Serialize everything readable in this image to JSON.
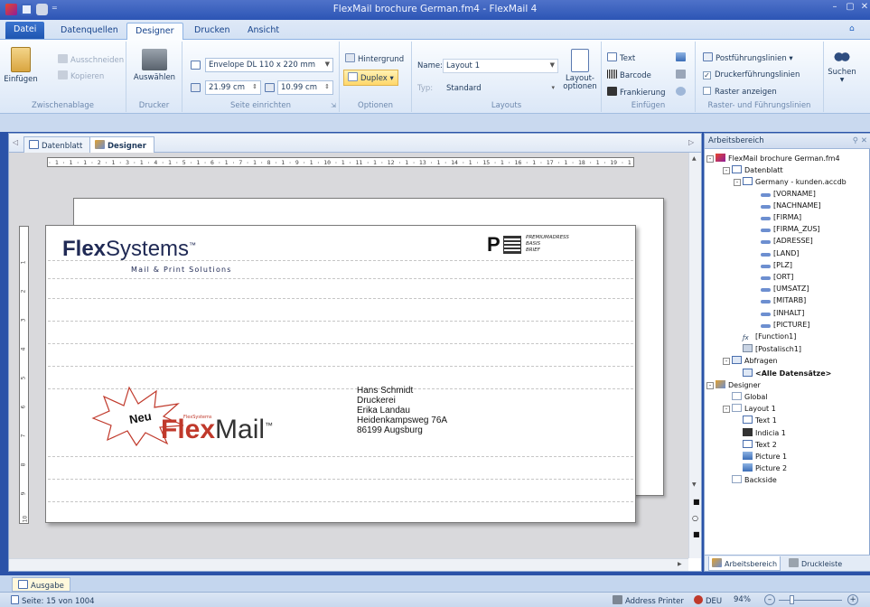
{
  "window": {
    "title": "FlexMail brochure German.fm4 - FlexMail 4",
    "qat": [
      "app-icon",
      "save-icon",
      "print-icon",
      "customize-arrow"
    ],
    "controls": [
      "minimize",
      "restore",
      "close"
    ]
  },
  "tabs": [
    {
      "label": "Datei",
      "active": false
    },
    {
      "label": "Datenquellen",
      "active": false
    },
    {
      "label": "Designer",
      "active": true
    },
    {
      "label": "Drucken",
      "active": false
    },
    {
      "label": "Ansicht",
      "active": false
    }
  ],
  "ribbon": {
    "clipboard": {
      "paste": "Einfügen",
      "cut": "Ausschneiden",
      "copy": "Kopieren",
      "label": "Zwischenablage"
    },
    "printer": {
      "select": "Auswählen",
      "label": "Drucker"
    },
    "page_setup": {
      "envelope": "Envelope DL 110 x 220 mm",
      "width": "21.99 cm",
      "height": "10.99 cm",
      "label": "Seite einrichten"
    },
    "options": {
      "background": "Hintergrund",
      "duplex": "Duplex",
      "label": "Optionen"
    },
    "layouts": {
      "name_label": "Name:",
      "name_value": "Layout 1",
      "type_label": "Typ:",
      "type_value": "Standard",
      "layout_options": "Layout-\noptionen",
      "label": "Layouts"
    },
    "insert": {
      "text": "Text",
      "barcode": "Barcode",
      "postage": "Frankierung",
      "label": "Einfügen"
    },
    "grid": {
      "postal_guides": "Postführungslinien",
      "printer_guides": "Druckerführungslinien",
      "show_grid": "Raster anzeigen",
      "printer_guides_checked": true,
      "show_grid_checked": false,
      "label": "Raster- und Führungslinien"
    },
    "search": {
      "label": "Suchen"
    }
  },
  "doc_tabs": [
    "Datenblatt",
    "Designer"
  ],
  "ruler_h": "· 1 · 1 · 1 · 2 · 1 · 3 · 1 · 4 · 1 · 5 · 1 · 6 · 1 · 7 · 1 · 8 · 1 · 9 · 1 · 10 · 1 · 11 · 1 · 12 · 1 · 13 · 1 · 14 · 1 · 15 · 1 · 16 · 1 · 17 · 1 · 18 · 1 · 19 · 1 · 20 · 1 · 21 · 1 ·",
  "ruler_v": [
    "1",
    "2",
    "3",
    "4",
    "5",
    "6",
    "7",
    "8",
    "9",
    "10"
  ],
  "envelope": {
    "logo_bold": "Flex",
    "logo_rest": "Systems",
    "logo_tm": "™",
    "logo_sub": "Mail & Print Solutions",
    "postage_p": "P",
    "postage_lines": [
      "PREMIUMADRESS",
      "BASIS",
      "BRIEF"
    ],
    "burst_text": "Neu",
    "flexmail_small": "FlexSystems",
    "flexmail_bold": "Flex",
    "flexmail_rest": "Mail",
    "flexmail_tm": "™",
    "address": [
      "Hans Schmidt",
      "Druckerei",
      "Erika Landau",
      "Heidenkampsweg 76A",
      "86199 Augsburg"
    ]
  },
  "panel": {
    "title": "Arbeitsbereich",
    "tree": [
      {
        "label": "FlexMail brochure German.fm4",
        "level": 0,
        "exp": "-",
        "icon": "project"
      },
      {
        "label": "Datenblatt",
        "level": 1,
        "exp": "-",
        "icon": "sheet"
      },
      {
        "label": "Germany - kunden.accdb",
        "level": 2,
        "exp": "-",
        "icon": "db"
      },
      {
        "label": "[VORNAME]",
        "level": 3,
        "icon": "field"
      },
      {
        "label": "[NACHNAME]",
        "level": 3,
        "icon": "field"
      },
      {
        "label": "[FIRMA]",
        "level": 3,
        "icon": "field"
      },
      {
        "label": "[FIRMA_ZUS]",
        "level": 3,
        "icon": "field"
      },
      {
        "label": "[ADRESSE]",
        "level": 3,
        "icon": "field"
      },
      {
        "label": "[LAND]",
        "level": 3,
        "icon": "field"
      },
      {
        "label": "[PLZ]",
        "level": 3,
        "icon": "field"
      },
      {
        "label": "[ORT]",
        "level": 3,
        "icon": "field"
      },
      {
        "label": "[UMSATZ]",
        "level": 3,
        "icon": "field"
      },
      {
        "label": "[MITARB]",
        "level": 3,
        "icon": "field"
      },
      {
        "label": "[INHALT]",
        "level": 3,
        "icon": "field"
      },
      {
        "label": "[PICTURE]",
        "level": 3,
        "icon": "field"
      },
      {
        "label": "[Function1]",
        "level": 2,
        "icon": "function"
      },
      {
        "label": "[Postalisch1]",
        "level": 2,
        "icon": "postal"
      },
      {
        "label": "Abfragen",
        "level": 1,
        "exp": "-",
        "icon": "query"
      },
      {
        "label": "<Alle Datensätze>",
        "level": 2,
        "icon": "query",
        "bold": true
      },
      {
        "label": "Designer",
        "level": 0,
        "exp": "-",
        "icon": "designer"
      },
      {
        "label": "Global",
        "level": 1,
        "icon": "page"
      },
      {
        "label": "Layout 1",
        "level": 1,
        "exp": "-",
        "icon": "page"
      },
      {
        "label": "Text 1",
        "level": 2,
        "icon": "text"
      },
      {
        "label": "Indicia 1",
        "level": 2,
        "icon": "indicia"
      },
      {
        "label": "Text 2",
        "level": 2,
        "icon": "text"
      },
      {
        "label": "Picture 1",
        "level": 2,
        "icon": "picture"
      },
      {
        "label": "Picture 2",
        "level": 2,
        "icon": "picture"
      },
      {
        "label": "Backside",
        "level": 1,
        "icon": "page"
      }
    ],
    "bottom_tabs": [
      "Arbeitsbereich",
      "Druckleiste"
    ]
  },
  "output_tab": "Ausgabe",
  "status": {
    "page": "Seite: 15 von 1004",
    "printer": "Address Printer",
    "lang": "DEU",
    "zoom": "94%"
  }
}
